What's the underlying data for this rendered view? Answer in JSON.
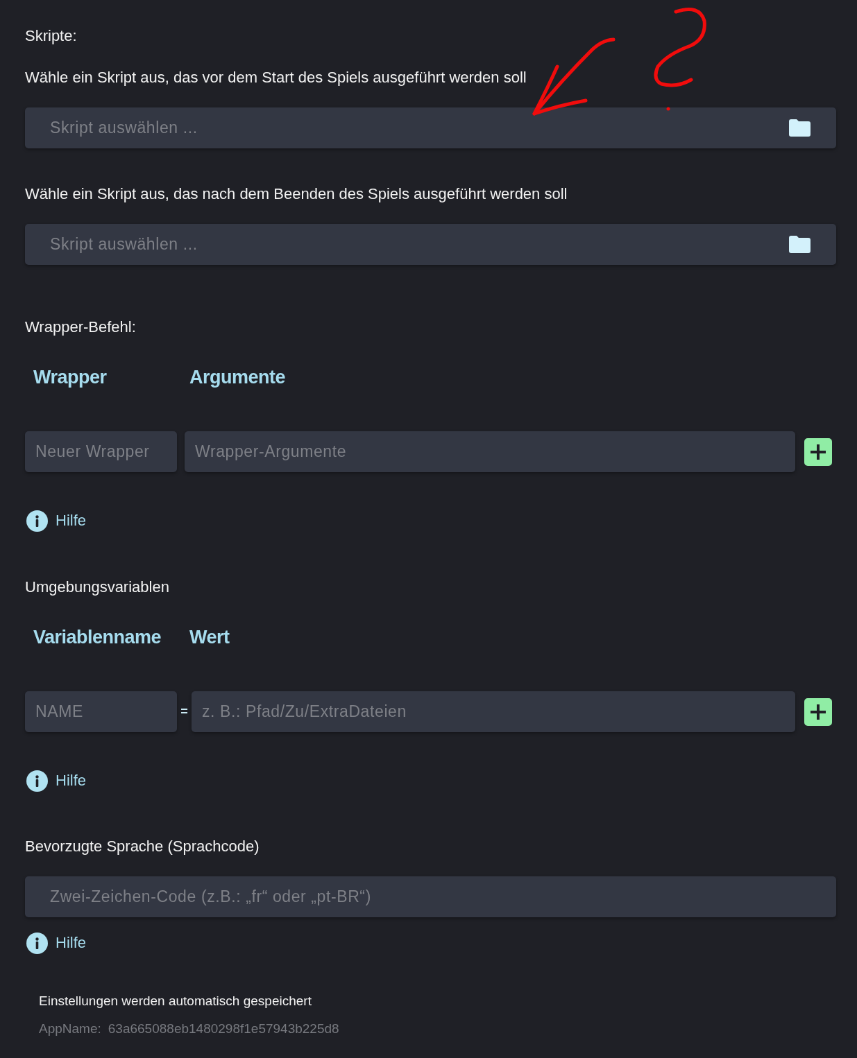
{
  "scripts": {
    "title": "Skripte:",
    "pickers": [
      {
        "label": "Wähle ein Skript aus, das vor dem Start des Spiels ausgeführt werden soll",
        "placeholder": "Skript auswählen ..."
      },
      {
        "label": "Wähle ein Skript aus, das nach dem Beenden des Spiels ausgeführt werden soll",
        "placeholder": "Skript auswählen ..."
      }
    ]
  },
  "wrapper": {
    "title": "Wrapper-Befehl:",
    "columns": [
      "Wrapper",
      "Argumente"
    ],
    "name_field": {
      "placeholder": "Neuer Wrapper"
    },
    "value_field": {
      "placeholder": "Wrapper-Argumente"
    },
    "help": "Hilfe"
  },
  "environment": {
    "title": "Umgebungsvariablen",
    "columns": [
      "Variablenname",
      "Wert"
    ],
    "name_field": {
      "placeholder": "NAME"
    },
    "separator": "=",
    "value_field": {
      "placeholder": "z. B.: Pfad/Zu/ExtraDateien"
    },
    "help": "Hilfe"
  },
  "language": {
    "title": "Bevorzugte Sprache (Sprachcode)",
    "field": {
      "placeholder": "Zwei-Zeichen-Code (z.B.: „fr“ oder „pt-BR“)"
    },
    "help": "Hilfe"
  },
  "footer": {
    "note": "Einstellungen werden automatisch gespeichert",
    "app_name_label": "AppName:",
    "app_name": "63a665088eb1480298f1e57943b225d8"
  }
}
